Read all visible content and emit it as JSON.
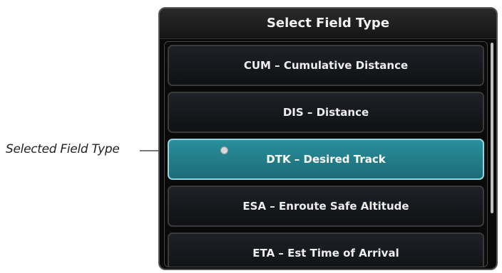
{
  "callout": {
    "label": "Selected  Field Type"
  },
  "dialog": {
    "title": "Select Field Type",
    "items": [
      {
        "label": "CUM – Cumulative Distance",
        "selected": false
      },
      {
        "label": "DIS – Distance",
        "selected": false
      },
      {
        "label": "DTK – Desired Track",
        "selected": true
      },
      {
        "label": "ESA – Enroute Safe Altitude",
        "selected": false
      },
      {
        "label": "ETA – Est Time of Arrival",
        "selected": false
      }
    ]
  },
  "colors": {
    "selected_fill": "#1f7a86",
    "selected_border": "#8fd6df",
    "dialog_bg": "#0a0a0a"
  }
}
